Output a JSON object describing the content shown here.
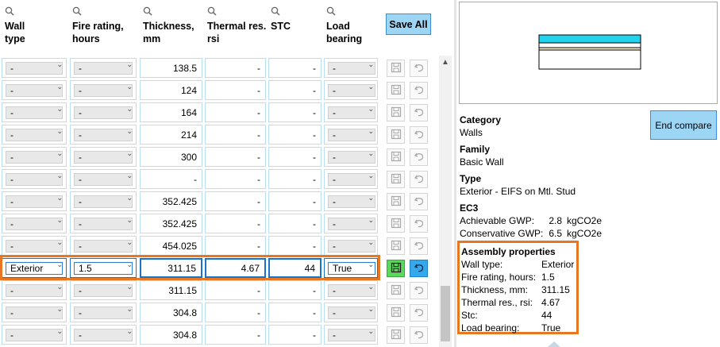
{
  "grid": {
    "headers": [
      {
        "label": "Wall\ntype"
      },
      {
        "label": "Fire rating,\nhours"
      },
      {
        "label": "Thickness,\nmm"
      },
      {
        "label": "Thermal res.\nrsi"
      },
      {
        "label": "STC"
      },
      {
        "label": "Load\nbearing"
      }
    ],
    "save_all_label": "Save All",
    "rows": [
      {
        "wall_type": "-",
        "fire_rating": "-",
        "thickness": "138.5",
        "thermal": "-",
        "stc": "-",
        "load_bearing": "-"
      },
      {
        "wall_type": "-",
        "fire_rating": "-",
        "thickness": "124",
        "thermal": "-",
        "stc": "-",
        "load_bearing": "-"
      },
      {
        "wall_type": "-",
        "fire_rating": "-",
        "thickness": "164",
        "thermal": "-",
        "stc": "-",
        "load_bearing": "-"
      },
      {
        "wall_type": "-",
        "fire_rating": "-",
        "thickness": "214",
        "thermal": "-",
        "stc": "-",
        "load_bearing": "-"
      },
      {
        "wall_type": "-",
        "fire_rating": "-",
        "thickness": "300",
        "thermal": "-",
        "stc": "-",
        "load_bearing": "-"
      },
      {
        "wall_type": "-",
        "fire_rating": "-",
        "thickness": "-",
        "thermal": "-",
        "stc": "-",
        "load_bearing": "-"
      },
      {
        "wall_type": "-",
        "fire_rating": "-",
        "thickness": "352.425",
        "thermal": "-",
        "stc": "-",
        "load_bearing": "-"
      },
      {
        "wall_type": "-",
        "fire_rating": "-",
        "thickness": "352.425",
        "thermal": "-",
        "stc": "-",
        "load_bearing": "-"
      },
      {
        "wall_type": "-",
        "fire_rating": "-",
        "thickness": "454.025",
        "thermal": "-",
        "stc": "-",
        "load_bearing": "-"
      },
      {
        "wall_type": "Exterior",
        "fire_rating": "1.5",
        "thickness": "311.15",
        "thermal": "4.67",
        "stc": "44",
        "load_bearing": "True",
        "selected": true
      },
      {
        "wall_type": "-",
        "fire_rating": "-",
        "thickness": "311.15",
        "thermal": "-",
        "stc": "-",
        "load_bearing": "-"
      },
      {
        "wall_type": "-",
        "fire_rating": "-",
        "thickness": "304.8",
        "thermal": "-",
        "stc": "-",
        "load_bearing": "-"
      },
      {
        "wall_type": "-",
        "fire_rating": "-",
        "thickness": "304.8",
        "thermal": "-",
        "stc": "-",
        "load_bearing": "-"
      }
    ]
  },
  "properties": {
    "category_title": "Category",
    "category_value": "Walls",
    "family_title": "Family",
    "family_value": "Basic Wall",
    "type_title": "Type",
    "type_value": "Exterior - EIFS on Mtl. Stud",
    "end_compare_label": "End compare",
    "ec3_title": "EC3",
    "achievable_label": "Achievable GWP:",
    "achievable_value": "2.8",
    "achievable_unit": "kgCO2e",
    "conservative_label": "Conservative GWP:",
    "conservative_value": "6.5",
    "conservative_unit": "kgCO2e",
    "assembly_title": "Assembly properties",
    "assembly": [
      {
        "label": "Wall type:",
        "value": "Exterior"
      },
      {
        "label": "Fire rating, hours:",
        "value": "1.5"
      },
      {
        "label": "Thickness, mm:",
        "value": "311.15"
      },
      {
        "label": "Thermal res., rsi:",
        "value": "4.67"
      },
      {
        "label": "Stc:",
        "value": "44"
      },
      {
        "label": "Load bearing:",
        "value": "True"
      }
    ]
  },
  "colors": {
    "accent_blue": "#9dd5f5",
    "highlight_orange": "#e87722",
    "save_green": "#5cd65c",
    "undo_blue": "#34a8ea",
    "wall_layer_cyan": "#22d3ee"
  },
  "icons": {
    "search": "magnifier-icon",
    "save": "floppy-disk-icon",
    "undo": "undo-arrow-icon",
    "dropdown": "chevron-down-icon"
  }
}
